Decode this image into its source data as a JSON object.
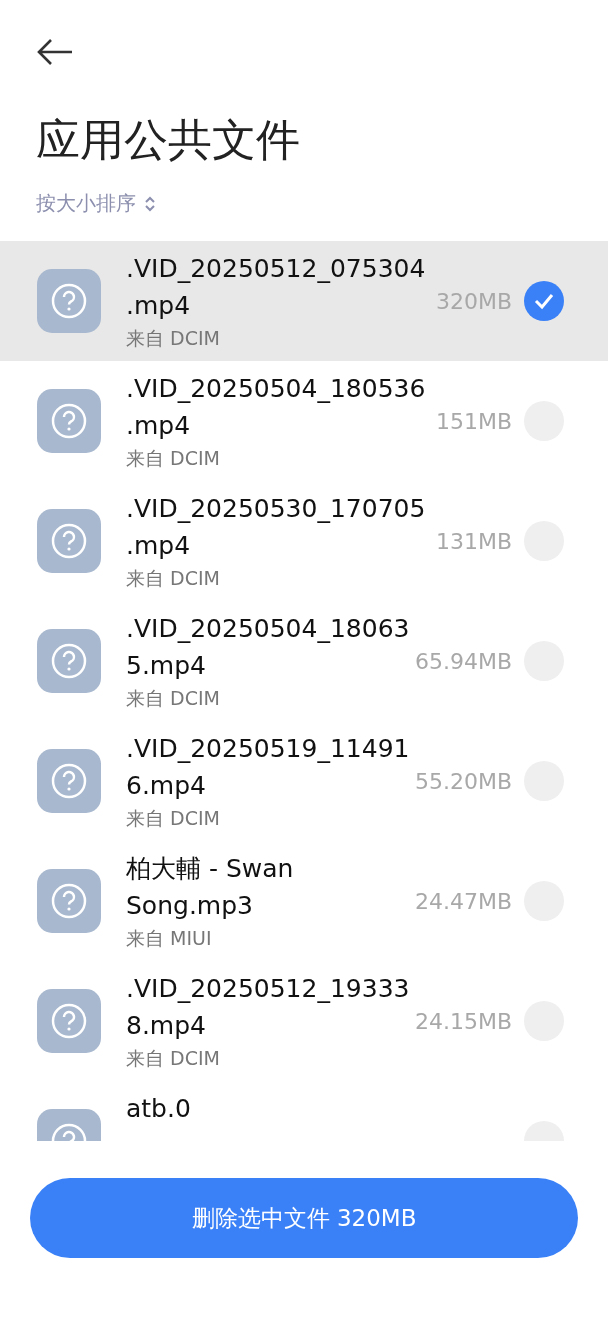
{
  "title": "应用公共文件",
  "sort": {
    "label": "按大小排序"
  },
  "files": [
    {
      "name": ".VID_20250512_075304.mp4",
      "source": "来自 DCIM",
      "size": "320MB",
      "selected": true
    },
    {
      "name": ".VID_20250504_180536.mp4",
      "source": "来自 DCIM",
      "size": "151MB",
      "selected": false
    },
    {
      "name": ".VID_20250530_170705.mp4",
      "source": "来自 DCIM",
      "size": "131MB",
      "selected": false
    },
    {
      "name": ".VID_20250504_180635.mp4",
      "source": "来自 DCIM",
      "size": "65.94MB",
      "selected": false
    },
    {
      "name": ".VID_20250519_114916.mp4",
      "source": "来自 DCIM",
      "size": "55.20MB",
      "selected": false
    },
    {
      "name": "柏大輔 - Swan Song.mp3",
      "source": "来自 MIUI",
      "size": "24.47MB",
      "selected": false
    },
    {
      "name": ".VID_20250512_193338.mp4",
      "source": "来自 DCIM",
      "size": "24.15MB",
      "selected": false
    },
    {
      "name": "atb.0",
      "selected": false
    }
  ],
  "delete_button": {
    "label": "删除选中文件 320MB"
  }
}
